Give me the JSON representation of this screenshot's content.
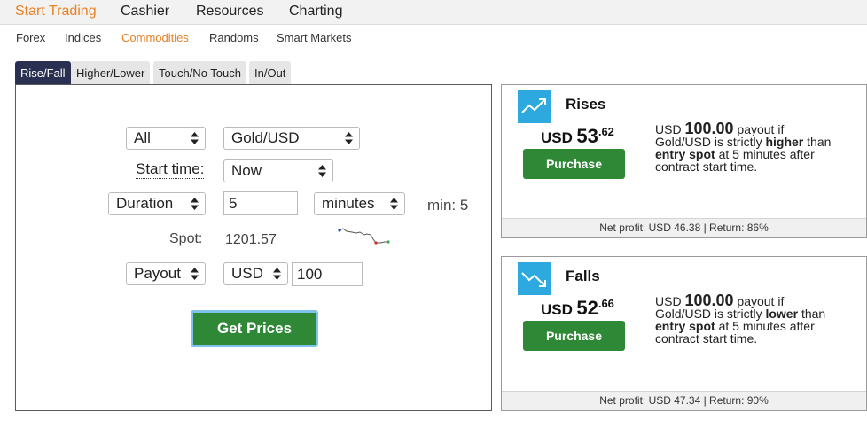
{
  "topnav": {
    "items": [
      {
        "label": "Start Trading",
        "active": true
      },
      {
        "label": "Cashier"
      },
      {
        "label": "Resources"
      },
      {
        "label": "Charting"
      }
    ]
  },
  "subnav": {
    "items": [
      {
        "label": "Forex"
      },
      {
        "label": "Indices"
      },
      {
        "label": "Commodities",
        "active": true
      },
      {
        "label": "Randoms"
      },
      {
        "label": "Smart Markets"
      }
    ]
  },
  "tabs": [
    {
      "label": "Rise/Fall",
      "active": true
    },
    {
      "label": "Higher/Lower"
    },
    {
      "label": "Touch/No Touch"
    },
    {
      "label": "In/Out"
    }
  ],
  "form": {
    "market_filter": "All",
    "underlying": "Gold/USD",
    "start_time_label": "Start time:",
    "start_time_value": "Now",
    "duration_type": "Duration",
    "duration_value": "5",
    "duration_unit": "minutes",
    "min_label": "min",
    "min_value": ": 5",
    "spot_label": "Spot:",
    "spot_value": "1201.57",
    "payout_type": "Payout",
    "currency": "USD",
    "amount": "100",
    "get_prices_label": "Get Prices"
  },
  "offers": [
    {
      "title": "Rises",
      "price_currency": "USD",
      "price_int": "53",
      "price_dec": ".62",
      "purchase_label": "Purchase",
      "desc_currency": "USD",
      "desc_amount": "100.00",
      "desc_text1": "payout if Gold/USD is strictly",
      "desc_direction": "higher",
      "desc_text2": "than",
      "desc_entry": "entry spot",
      "desc_text3": "at 5 minutes after contract start time.",
      "footer": "Net profit: USD 46.38 | Return: 86%"
    },
    {
      "title": "Falls",
      "price_currency": "USD",
      "price_int": "52",
      "price_dec": ".66",
      "purchase_label": "Purchase",
      "desc_currency": "USD",
      "desc_amount": "100.00",
      "desc_text1": "payout if Gold/USD is strictly",
      "desc_direction": "lower",
      "desc_text2": "than",
      "desc_entry": "entry spot",
      "desc_text3": "at 5 minutes after contract start time.",
      "footer": "Net profit: USD 47.34 | Return: 90%"
    }
  ],
  "colors": {
    "accent": "#e98024",
    "active_tab": "#2a3052",
    "purchase_green": "#2e8836",
    "icon_blue": "#2ea9df"
  }
}
